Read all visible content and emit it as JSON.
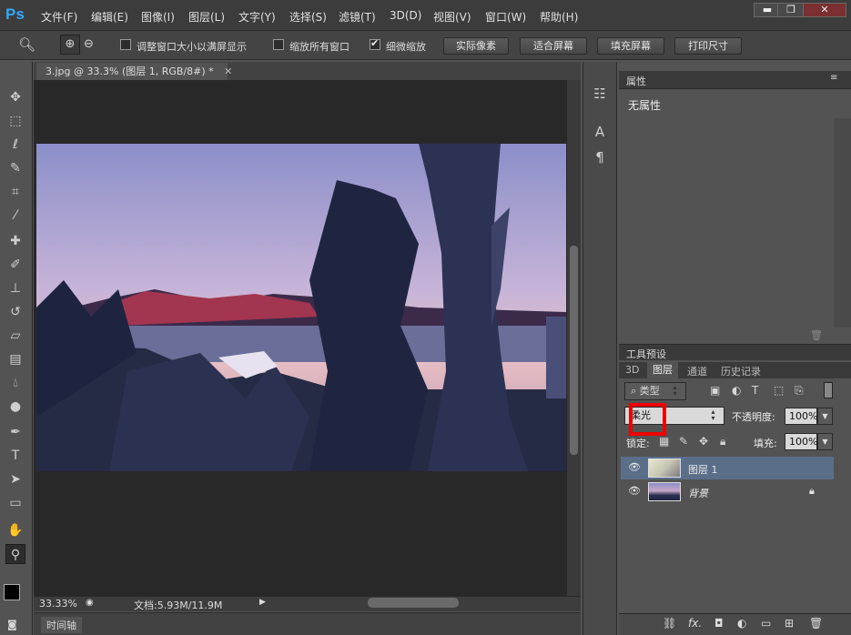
{
  "app": {
    "logo": "Ps"
  },
  "menu": [
    "文件(F)",
    "编辑(E)",
    "图像(I)",
    "图层(L)",
    "文字(Y)",
    "选择(S)",
    "滤镜(T)",
    "3D(D)",
    "视图(V)",
    "窗口(W)",
    "帮助(H)"
  ],
  "window_controls": {
    "minimize": "▬",
    "restore": "❐",
    "close": "✕"
  },
  "options": {
    "resize_windows": "调整窗口大小以满屏显示",
    "zoom_all": "缩放所有窗口",
    "scrubby_zoom": "细微缩放",
    "actual_pixels": "实际像素",
    "fit_screen": "适合屏幕",
    "fill_screen": "填充屏幕",
    "print_size": "打印尺寸"
  },
  "document": {
    "tab_title": "3.jpg @ 33.3% (图层 1, RGB/8#) *",
    "zoom": "33.33%",
    "doc_size": "文档:5.93M/11.9M"
  },
  "timeline": "时间轴",
  "properties": {
    "title": "属性",
    "content": "无属性"
  },
  "tool_presets": {
    "title": "工具预设"
  },
  "layers_panel": {
    "tabs": [
      "3D",
      "图层",
      "通道",
      "历史记录"
    ],
    "filter_kind": "类型",
    "blend_mode": "柔光",
    "opacity_label": "不透明度:",
    "opacity_value": "100%",
    "lock_label": "锁定:",
    "fill_label": "填充:",
    "fill_value": "100%",
    "layers": [
      {
        "name": "图层 1",
        "selected": true
      },
      {
        "name": "背景",
        "selected": false
      }
    ],
    "footer_fx": "fx."
  },
  "colors": {
    "highlight": "#e00000",
    "selection": "#5a6e8a"
  }
}
